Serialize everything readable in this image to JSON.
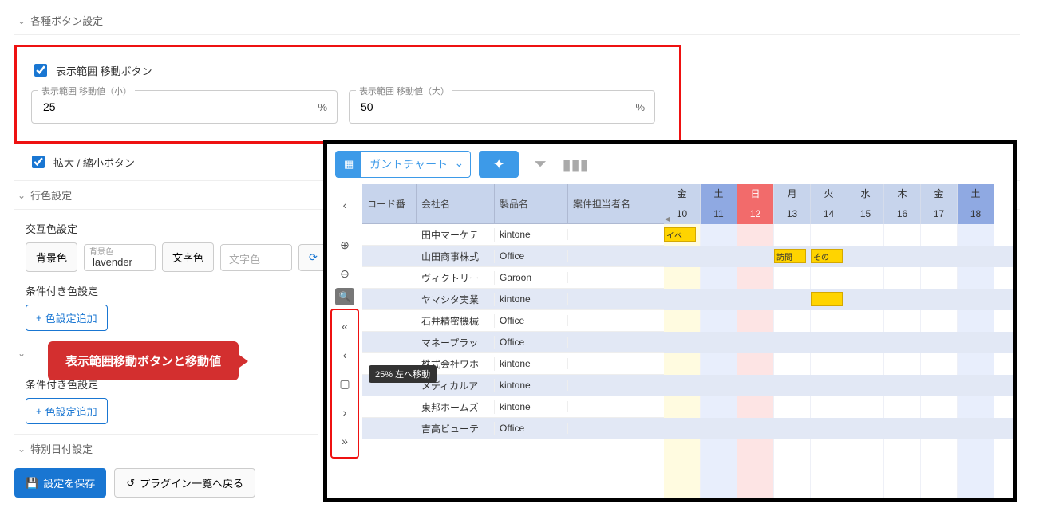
{
  "section": {
    "button_settings": "各種ボタン設定",
    "row_color": "行色設定",
    "special_date": "特別日付設定"
  },
  "range_move": {
    "checkbox_label": "表示範囲 移動ボタン",
    "small_label": "表示範囲 移動値（小）",
    "small_value": "25",
    "large_label": "表示範囲 移動値（大）",
    "large_value": "50",
    "unit": "%"
  },
  "zoom_checkbox": "拡大 / 縮小ボタン",
  "alt_color": {
    "title": "交互色設定",
    "bg_btn": "背景色",
    "bg_label": "背景色",
    "bg_value": "lavender",
    "fg_btn": "文字色",
    "fg_placeholder": "文字色"
  },
  "cond_color_title": "条件付き色設定",
  "cond_color_title_2": "条件付き色設定",
  "add_color_btn": "色設定追加",
  "callout": "表示範囲移動ボタンと移動値",
  "save_btn": "設定を保存",
  "back_btn": "プラグイン一覧へ戻る",
  "gantt": {
    "view_label": "ガントチャート",
    "tooltip": "25% 左へ移動",
    "columns": [
      "コード番",
      "会社名",
      "製品名",
      "案件担当者名"
    ],
    "days": [
      {
        "wd": "金",
        "num": "10",
        "cls": "fri"
      },
      {
        "wd": "土",
        "num": "11",
        "cls": "sat"
      },
      {
        "wd": "日",
        "num": "12",
        "cls": "sun"
      },
      {
        "wd": "月",
        "num": "13",
        "cls": ""
      },
      {
        "wd": "火",
        "num": "14",
        "cls": ""
      },
      {
        "wd": "水",
        "num": "15",
        "cls": ""
      },
      {
        "wd": "木",
        "num": "16",
        "cls": ""
      },
      {
        "wd": "金",
        "num": "17",
        "cls": ""
      },
      {
        "wd": "土",
        "num": "18",
        "cls": "sat"
      }
    ],
    "rows": [
      {
        "company": "田中マーケテ",
        "product": "kintone",
        "bars": [
          {
            "col": 0,
            "w": 1,
            "label": "イベ"
          }
        ]
      },
      {
        "company": "山田商事株式",
        "product": "Office",
        "bars": [
          {
            "col": 3,
            "w": 1,
            "label": "訪問"
          },
          {
            "col": 4,
            "w": 1,
            "label": "その"
          }
        ]
      },
      {
        "company": "ヴィクトリー",
        "product": "Garoon",
        "bars": []
      },
      {
        "company": "ヤマシタ実業",
        "product": "kintone",
        "bars": [
          {
            "col": 4,
            "w": 1,
            "label": ""
          }
        ]
      },
      {
        "company": "石井精密機械",
        "product": "Office",
        "bars": []
      },
      {
        "company": "マネープラッ",
        "product": "Office",
        "bars": []
      },
      {
        "company": "株式会社ワホ",
        "product": "kintone",
        "bars": []
      },
      {
        "company": "メディカルア",
        "product": "kintone",
        "bars": []
      },
      {
        "company": "東邦ホームズ",
        "product": "kintone",
        "bars": []
      },
      {
        "company": "吉高ビューテ",
        "product": "Office",
        "bars": []
      }
    ]
  }
}
